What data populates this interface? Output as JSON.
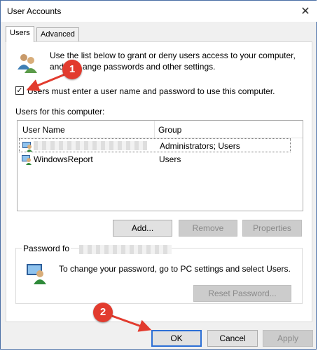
{
  "window": {
    "title": "User Accounts",
    "close_glyph": "✕"
  },
  "tabs": [
    {
      "label": "Users",
      "active": true
    },
    {
      "label": "Advanced",
      "active": false
    }
  ],
  "intro": {
    "line1": "Use the list below to grant or deny users access to your computer,",
    "line2_start": "and",
    "line2_end": "ange passwords and other settings."
  },
  "require_login": {
    "checked": true,
    "label": "Users must enter a user name and password to use this computer."
  },
  "users_section": {
    "label": "Users for this computer:",
    "columns": [
      "User Name",
      "Group"
    ],
    "rows": [
      {
        "user_name": "",
        "group": "Administrators; Users",
        "selected": true
      },
      {
        "user_name": "WindowsReport",
        "group": "Users",
        "selected": false
      }
    ]
  },
  "list_buttons": {
    "add": "Add...",
    "remove": "Remove",
    "properties": "Properties"
  },
  "password_group": {
    "legend": "Password fo",
    "text": "To change your password, go to PC settings and select Users.",
    "reset_button": "Reset Password..."
  },
  "dialog_buttons": {
    "ok": "OK",
    "cancel": "Cancel",
    "apply": "Apply"
  },
  "annotations": [
    {
      "label": "1"
    },
    {
      "label": "2"
    }
  ],
  "colors": {
    "accent": "#2c6fd6",
    "marker": "#e23b2e"
  }
}
